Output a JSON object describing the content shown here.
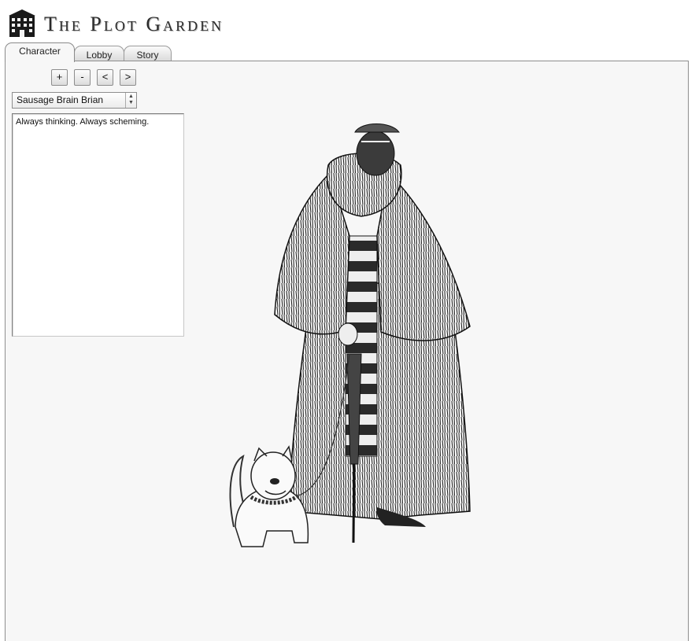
{
  "header": {
    "title": "The Plot Garden",
    "logo_icon": "building-icon"
  },
  "tabs": [
    {
      "label": "Character",
      "active": true
    },
    {
      "label": "Lobby",
      "active": false
    },
    {
      "label": "Story",
      "active": false
    }
  ],
  "controls": {
    "add_label": "+",
    "remove_label": "-",
    "prev_label": "<",
    "next_label": ">"
  },
  "character": {
    "selected": "Sausage Brain Brian",
    "description": "Always thinking. Always scheming.",
    "portrait_icon": "character-illustration"
  }
}
